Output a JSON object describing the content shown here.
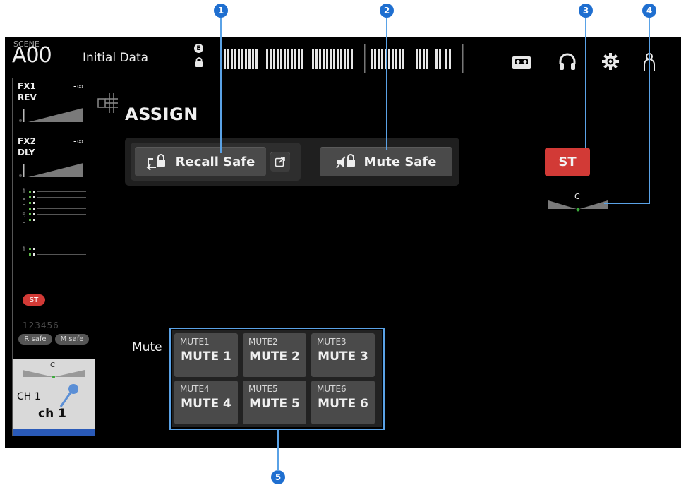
{
  "callouts": [
    "1",
    "2",
    "3",
    "4",
    "5"
  ],
  "header": {
    "scene_label": "SCENE",
    "scene_number": "A00",
    "scene_name": "Initial Data",
    "edit_indicator": "E"
  },
  "icons": {
    "lock": "lock-icon",
    "recorder": "recorder-icon",
    "headphones": "headphones-icon",
    "setup": "gear-icon",
    "user": "user-icon"
  },
  "sidebar": {
    "fx1": {
      "name": "FX1",
      "type": "REV",
      "level": "-∞"
    },
    "fx2": {
      "name": "FX2",
      "type": "DLY",
      "level": "-∞"
    },
    "meter_labels_a": [
      "1",
      "5"
    ],
    "meter_labels_b": [
      "1"
    ],
    "st_badge": "ST",
    "mute_group_indicators": "123456",
    "r_safe": "R safe",
    "m_safe": "M safe",
    "pan_label": "C",
    "channel_number": "CH 1",
    "channel_name": "ch 1"
  },
  "main": {
    "title": "ASSIGN",
    "recall_safe_label": "Recall Safe",
    "mute_safe_label": "Mute Safe",
    "st_label": "ST",
    "pan_label": "C",
    "mute_label": "Mute",
    "mute_buttons": [
      {
        "small": "MUTE1",
        "big": "MUTE 1"
      },
      {
        "small": "MUTE2",
        "big": "MUTE 2"
      },
      {
        "small": "MUTE3",
        "big": "MUTE 3"
      },
      {
        "small": "MUTE4",
        "big": "MUTE 4"
      },
      {
        "small": "MUTE5",
        "big": "MUTE 5"
      },
      {
        "small": "MUTE6",
        "big": "MUTE 6"
      }
    ]
  },
  "colors": {
    "accent_red": "#d23a36",
    "callout_blue": "#1f6fd0",
    "highlight_blue": "#5aa2e6",
    "channel_blue": "#2a5ab8"
  }
}
